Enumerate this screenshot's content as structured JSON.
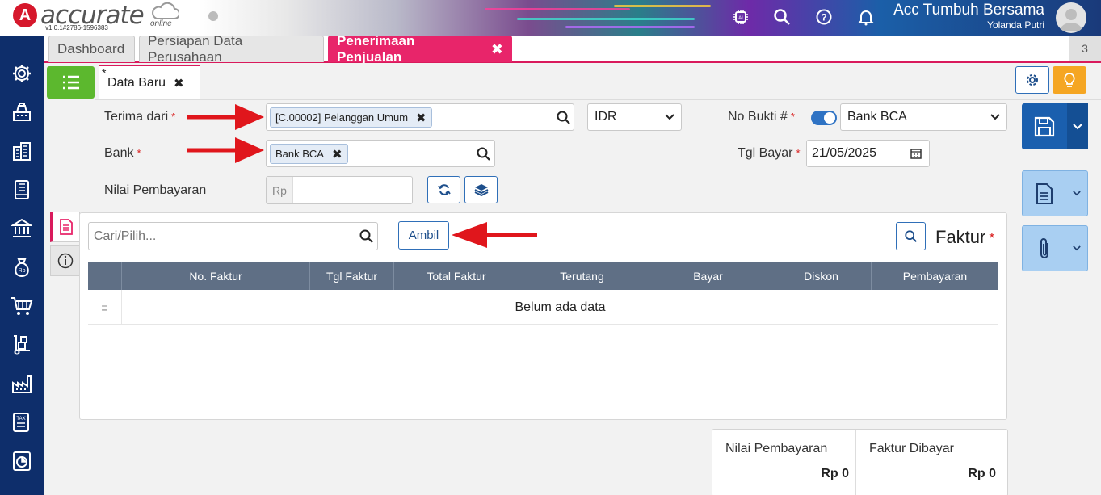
{
  "app": {
    "logo_text": "accurate",
    "logo_sub": "online",
    "version": "v1.0.1#2786-1596383",
    "company": "Acc Tumbuh Bersama",
    "user": "Yolanda Putri"
  },
  "header_icons": [
    "ai-chip-icon",
    "search-icon",
    "help-icon",
    "bell-icon"
  ],
  "sidebar_icons": [
    "gear-icon",
    "cash-register-icon",
    "building-icon",
    "book-icon",
    "bank-icon",
    "money-bag-icon",
    "cart-icon",
    "hand-truck-icon",
    "factory-icon",
    "tax-icon",
    "report-icon"
  ],
  "module_tabs": [
    {
      "label": "Dashboard"
    },
    {
      "label": "Persiapan Data Perusahaan"
    },
    {
      "label": "Penerimaan Penjualan",
      "close": "✖"
    }
  ],
  "tab_count": "3",
  "doc_tab": {
    "star": "*",
    "label": "Data Baru",
    "close": "✖"
  },
  "form": {
    "terima_dari_label": "Terima dari",
    "terima_dari_value": "[C.00002] Pelanggan Umum",
    "currency": "IDR",
    "no_bukti_label": "No Bukti #",
    "no_bukti_value": "Bank BCA",
    "bank_label": "Bank",
    "bank_value": "Bank BCA",
    "tgl_bayar_label": "Tgl Bayar",
    "tgl_bayar_value": "21/05/2025",
    "nilai_label": "Nilai Pembayaran",
    "nilai_prefix": "Rp",
    "required_mark": "*",
    "chip_close": "✖"
  },
  "faktur": {
    "search_placeholder": "Cari/Pilih...",
    "ambil": "Ambil",
    "title": "Faktur",
    "columns": [
      "No. Faktur",
      "Tgl Faktur",
      "Total Faktur",
      "Terutang",
      "Bayar",
      "Diskon",
      "Pembayaran"
    ],
    "empty": "Belum ada data",
    "row_handle": "≡"
  },
  "summary": {
    "nilai_label": "Nilai Pembayaran",
    "nilai_value": "Rp 0",
    "faktur_label": "Faktur Dibayar",
    "faktur_value": "Rp 0"
  },
  "colors": {
    "accent": "#e8256a",
    "sidebar": "#0e2e6b",
    "primary": "#2f6fb8",
    "green": "#5cb82e",
    "orange": "#f5a623",
    "arrow": "#e0161c"
  }
}
